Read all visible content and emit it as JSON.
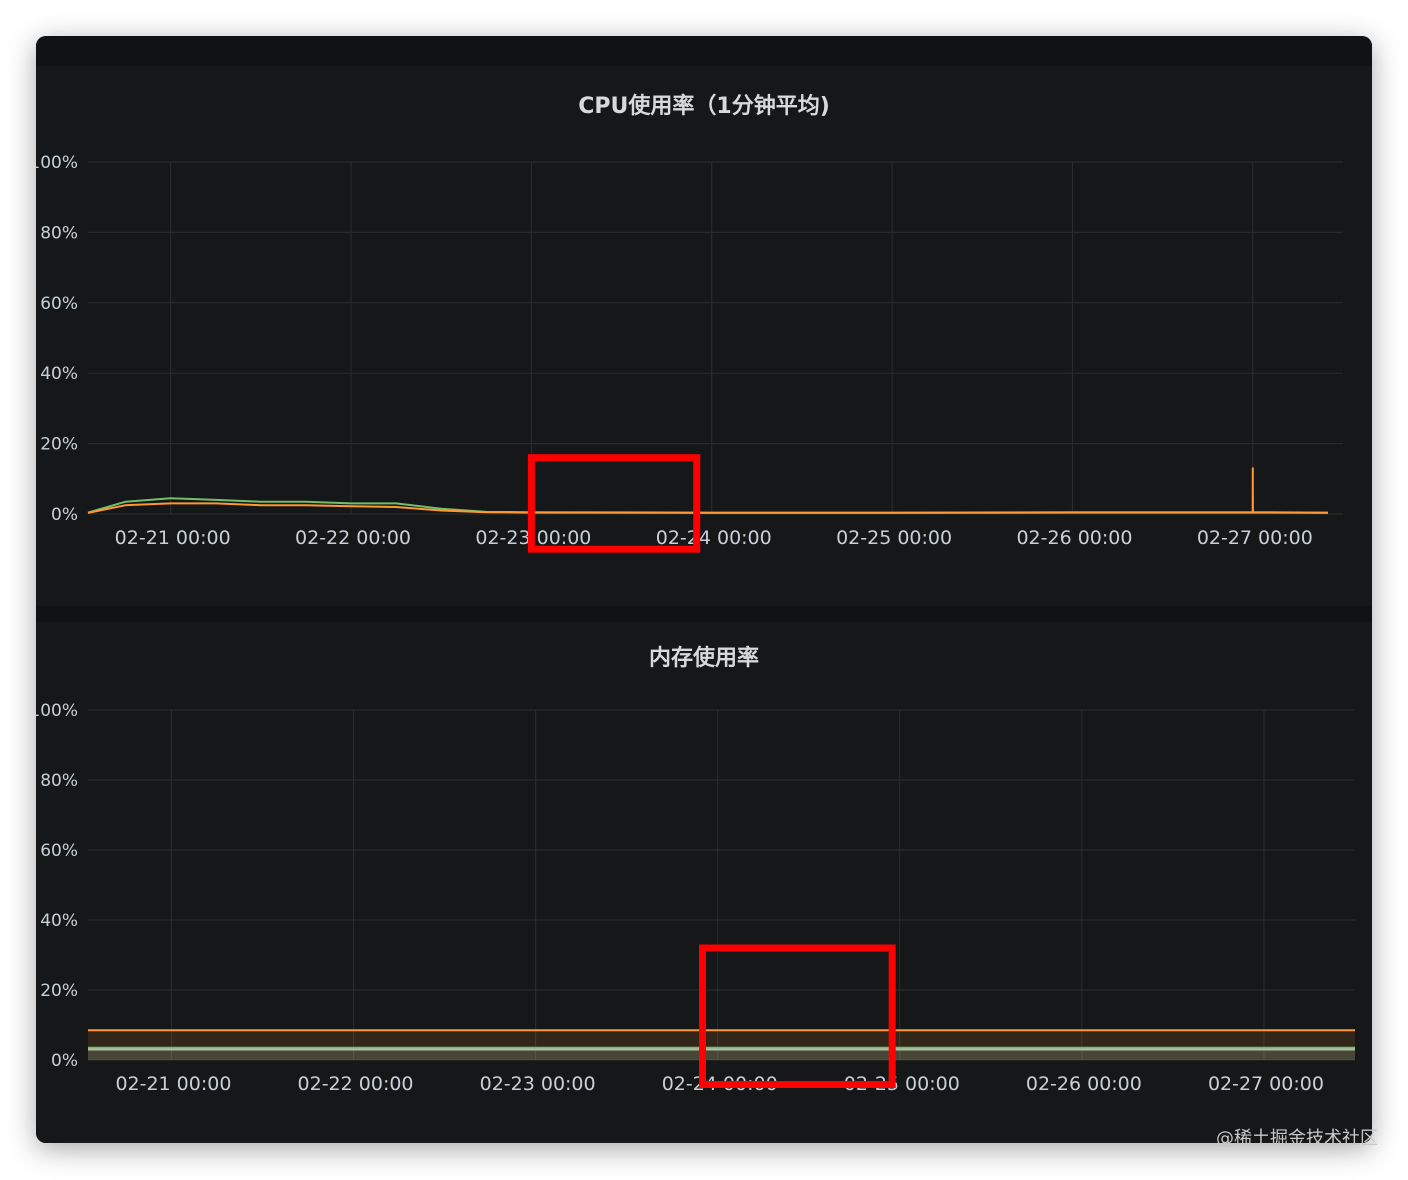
{
  "chart_data": [
    {
      "type": "line",
      "title": "CPU使用率（1分钟平均)",
      "yticks": [
        "0%",
        "20%",
        "40%",
        "60%",
        "80%",
        "100%"
      ],
      "xticks": [
        "02-21 00:00",
        "02-22 00:00",
        "02-23 00:00",
        "02-24 00:00",
        "02-25 00:00",
        "02-26 00:00",
        "02-27 00:00"
      ],
      "ylim": [
        0,
        100
      ],
      "grid": true,
      "colors": {
        "series_a": "#73bf69",
        "series_b": "#ff9830",
        "series_c": "#5794f2",
        "highlight": "#ff0000"
      },
      "series": [
        {
          "x": [
            "02-20 13:00",
            "02-20 18:00",
            "02-21 00:00",
            "02-21 06:00",
            "02-21 12:00",
            "02-21 18:00",
            "02-22 00:00",
            "02-22 06:00",
            "02-22 12:00",
            "02-22 18:00",
            "02-23 00:00",
            "02-24 00:00",
            "02-25 00:00",
            "02-26 00:00",
            "02-27 00:00",
            "02-27 10:00"
          ],
          "values": [
            0.4,
            3.5,
            4.5,
            4,
            3.5,
            3.5,
            3,
            3,
            1.5,
            0.6,
            0.5,
            0.4,
            0.4,
            0.5,
            0.5,
            0.4
          ]
        },
        {
          "x": [
            "02-20 13:00",
            "02-20 18:00",
            "02-21 00:00",
            "02-21 06:00",
            "02-21 12:00",
            "02-21 18:00",
            "02-22 00:00",
            "02-22 06:00",
            "02-22 12:00",
            "02-22 18:00",
            "02-23 00:00",
            "02-24 00:00",
            "02-25 00:00",
            "02-26 00:00",
            "02-26 23:59",
            "02-27 00:00",
            "02-27 00:01",
            "02-27 10:00"
          ],
          "values": [
            0.3,
            2.5,
            3,
            3,
            2.5,
            2.5,
            2.2,
            2,
            1,
            0.5,
            0.4,
            0.3,
            0.3,
            0.4,
            0.4,
            13,
            0.4,
            0.3
          ]
        }
      ],
      "highlight_box": {
        "x_start": "02-23 00:00",
        "x_end": "02-23 22:00",
        "y_range": [
          -10,
          16
        ]
      }
    },
    {
      "type": "area",
      "title": "内存使用率",
      "yticks": [
        "0%",
        "20%",
        "40%",
        "60%",
        "80%",
        "100%"
      ],
      "xticks": [
        "02-21 00:00",
        "02-22 00:00",
        "02-23 00:00",
        "02-24 00:00",
        "02-25 00:00",
        "02-26 00:00",
        "02-27 00:00"
      ],
      "ylim": [
        0,
        100
      ],
      "grid": true,
      "colors": {
        "series_a": "#ff9830",
        "series_b": "#73bf69",
        "series_c": "#b8b8b8"
      },
      "series": [
        {
          "x": [
            "02-20 13:00",
            "02-27 12:00"
          ],
          "values": [
            8.5,
            8.5
          ]
        },
        {
          "x": [
            "02-20 13:00",
            "02-27 12:00"
          ],
          "values": [
            3.5,
            3.5
          ]
        },
        {
          "x": [
            "02-20 13:00",
            "02-27 12:00"
          ],
          "values": [
            3.0,
            3.0
          ]
        }
      ],
      "highlight_box": {
        "x_start": "02-23 22:00",
        "x_end": "02-24 23:00",
        "y_range": [
          -7,
          32
        ]
      }
    }
  ],
  "watermark": "@稀土掘金技术社区"
}
